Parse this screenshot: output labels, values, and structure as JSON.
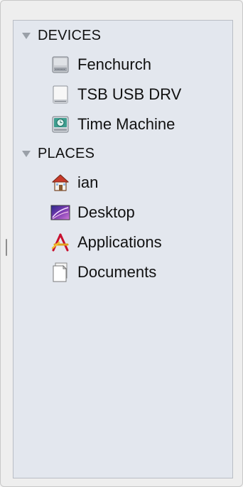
{
  "sidebar": {
    "sections": [
      {
        "label": "DEVICES",
        "items": [
          {
            "label": "Fenchurch",
            "icon": "internal-hard-drive-icon"
          },
          {
            "label": "TSB USB DRV",
            "icon": "external-drive-icon"
          },
          {
            "label": "Time Machine",
            "icon": "time-machine-drive-icon"
          }
        ]
      },
      {
        "label": "PLACES",
        "items": [
          {
            "label": "ian",
            "icon": "home-icon"
          },
          {
            "label": "Desktop",
            "icon": "desktop-icon"
          },
          {
            "label": "Applications",
            "icon": "applications-icon"
          },
          {
            "label": "Documents",
            "icon": "documents-icon"
          }
        ]
      }
    ]
  }
}
